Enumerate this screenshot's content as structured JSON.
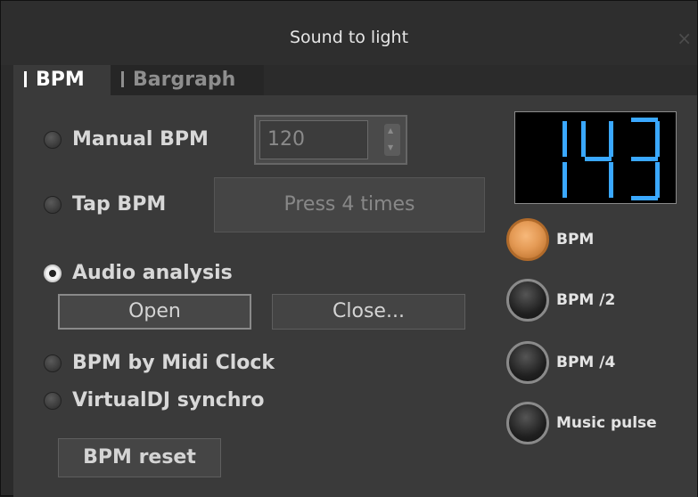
{
  "window": {
    "title": "Sound to light",
    "close_symbol": "×"
  },
  "tabs": [
    {
      "label": "BPM",
      "active": true
    },
    {
      "label": "Bargraph",
      "active": false
    }
  ],
  "modes": {
    "manual_bpm": {
      "label": "Manual BPM",
      "checked": false,
      "value": "120"
    },
    "tap_bpm": {
      "label": "Tap BPM",
      "checked": false,
      "button_label": "Press 4 times"
    },
    "audio_analysis": {
      "label": "Audio analysis",
      "checked": true,
      "open_label": "Open",
      "close_label": "Close..."
    },
    "midi_clock": {
      "label": "BPM by Midi Clock",
      "checked": false
    },
    "virtualdj": {
      "label": "VirtualDJ synchro",
      "checked": false
    }
  },
  "reset_label": "BPM reset",
  "display": {
    "value": "143",
    "color": "#3aa8ff"
  },
  "leds": [
    {
      "label": "BPM",
      "on": true
    },
    {
      "label": "BPM /2",
      "on": false
    },
    {
      "label": "BPM /4",
      "on": false
    },
    {
      "label": "Music pulse",
      "on": false
    }
  ],
  "colors": {
    "led_on": "#e49a55",
    "background": "#3a3a3a"
  }
}
